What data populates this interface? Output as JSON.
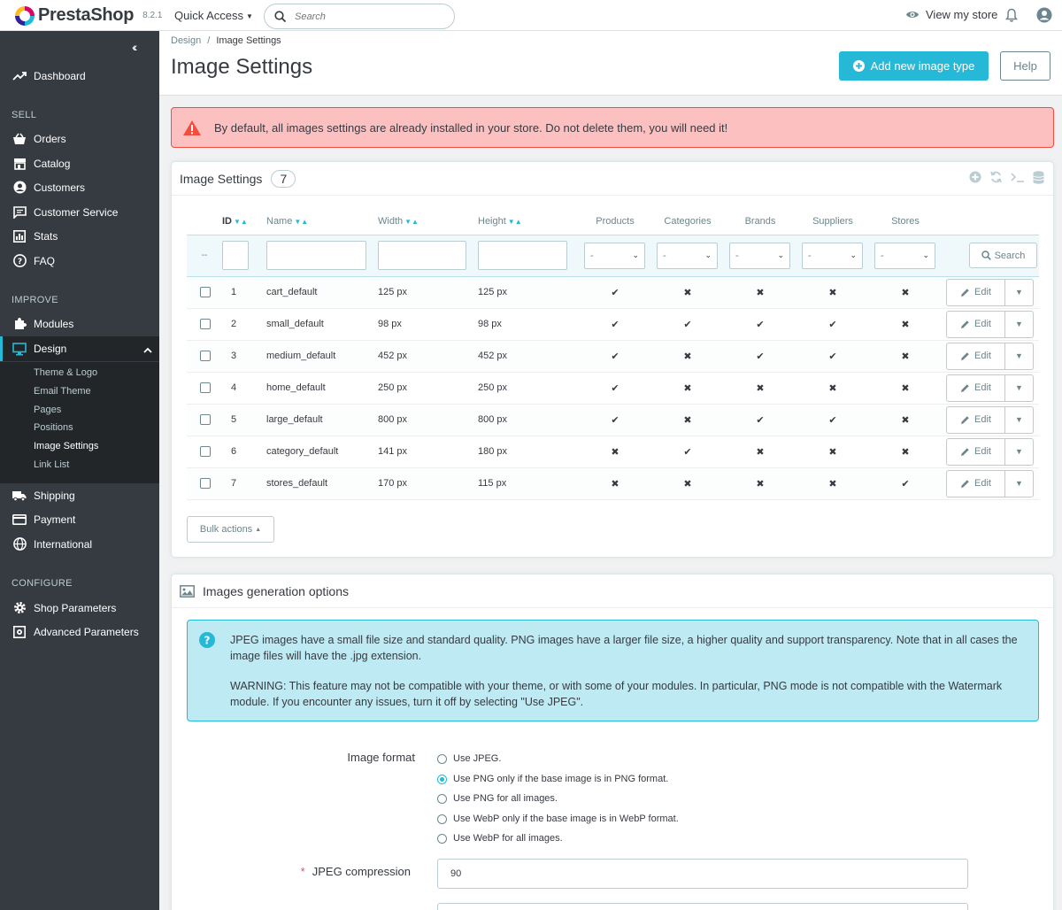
{
  "header": {
    "brand": "PrestaShop",
    "version": "8.2.1",
    "quick_access": "Quick Access",
    "search_placeholder": "Search",
    "view_store": "View my store"
  },
  "sidebar": {
    "dashboard": "Dashboard",
    "sections": {
      "sell": "SELL",
      "improve": "IMPROVE",
      "configure": "CONFIGURE"
    },
    "sell_items": [
      "Orders",
      "Catalog",
      "Customers",
      "Customer Service",
      "Stats",
      "FAQ"
    ],
    "improve_items": [
      "Modules",
      "Design",
      "Shipping",
      "Payment",
      "International"
    ],
    "design_submenu": [
      "Theme & Logo",
      "Email Theme",
      "Pages",
      "Positions",
      "Image Settings",
      "Link List"
    ],
    "configure_items": [
      "Shop Parameters",
      "Advanced Parameters"
    ]
  },
  "page": {
    "breadcrumb": [
      "Design",
      "Image Settings"
    ],
    "title": "Image Settings",
    "add_button": "Add new image type",
    "help_button": "Help"
  },
  "alert_warning": "By default, all images settings are already installed in your store. Do not delete them, you will need it!",
  "list_panel": {
    "title": "Image Settings",
    "count": "7",
    "columns": [
      "ID",
      "Name",
      "Width",
      "Height",
      "Products",
      "Categories",
      "Brands",
      "Suppliers",
      "Stores"
    ],
    "filter_dash": "--",
    "select_value": "-",
    "search_button": "Search",
    "edit_label": "Edit",
    "bulk_actions": "Bulk actions",
    "rows": [
      {
        "id": "1",
        "name": "cart_default",
        "width": "125 px",
        "height": "125 px",
        "products": true,
        "categories": false,
        "brands": false,
        "suppliers": false,
        "stores": false
      },
      {
        "id": "2",
        "name": "small_default",
        "width": "98 px",
        "height": "98 px",
        "products": true,
        "categories": true,
        "brands": true,
        "suppliers": true,
        "stores": false
      },
      {
        "id": "3",
        "name": "medium_default",
        "width": "452 px",
        "height": "452 px",
        "products": true,
        "categories": false,
        "brands": true,
        "suppliers": true,
        "stores": false
      },
      {
        "id": "4",
        "name": "home_default",
        "width": "250 px",
        "height": "250 px",
        "products": true,
        "categories": false,
        "brands": false,
        "suppliers": false,
        "stores": false
      },
      {
        "id": "5",
        "name": "large_default",
        "width": "800 px",
        "height": "800 px",
        "products": true,
        "categories": false,
        "brands": true,
        "suppliers": true,
        "stores": false
      },
      {
        "id": "6",
        "name": "category_default",
        "width": "141 px",
        "height": "180 px",
        "products": false,
        "categories": true,
        "brands": false,
        "suppliers": false,
        "stores": false
      },
      {
        "id": "7",
        "name": "stores_default",
        "width": "170 px",
        "height": "115 px",
        "products": false,
        "categories": false,
        "brands": false,
        "suppliers": false,
        "stores": true
      }
    ]
  },
  "options_panel": {
    "title": "Images generation options",
    "info_p1": "JPEG images have a small file size and standard quality. PNG images have a larger file size, a higher quality and support transparency. Note that in all cases the image files will have the .jpg extension.",
    "info_p2": "WARNING: This feature may not be compatible with your theme, or with some of your modules. In particular, PNG mode is not compatible with the Watermark module. If you encounter any issues, turn it off by selecting \"Use JPEG\".",
    "image_format_label": "Image format",
    "formats": [
      "Use JPEG.",
      "Use PNG only if the base image is in PNG format.",
      "Use PNG for all images.",
      "Use WebP only if the base image is in WebP format.",
      "Use WebP for all images."
    ],
    "selected_format_index": 1,
    "jpeg_label": "JPEG compression",
    "jpeg_required_mark": "*",
    "jpeg_value": "90"
  },
  "colors": {
    "accent": "#25b9d7",
    "sidebar": "#363a41",
    "yes": "#70b580",
    "no": "#e08f95",
    "danger_bg": "#fcc0c0"
  }
}
